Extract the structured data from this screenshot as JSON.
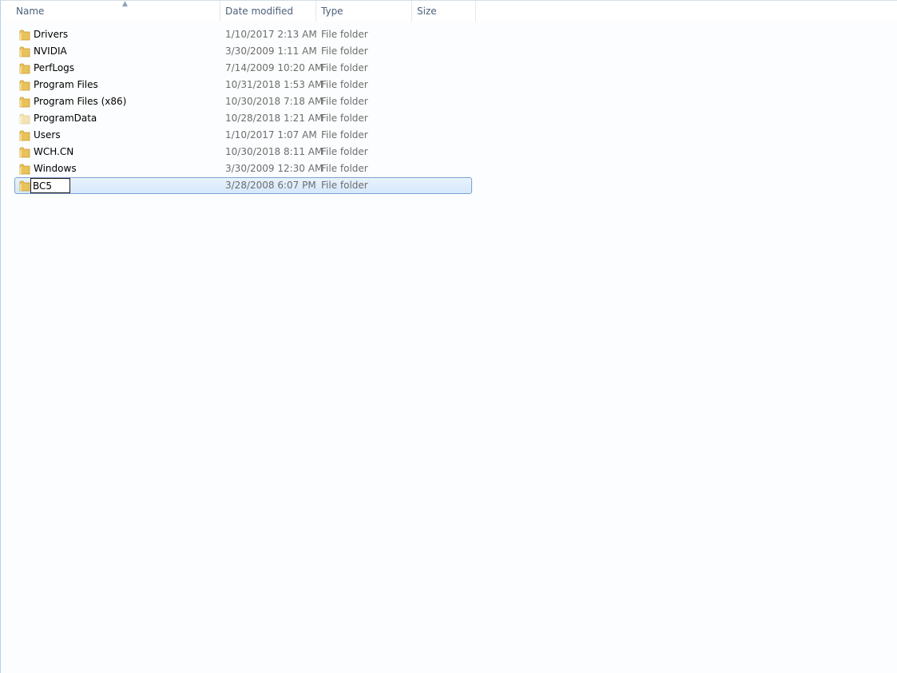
{
  "columns": {
    "name": "Name",
    "date": "Date modified",
    "type": "Type",
    "size": "Size",
    "sort_indicator": "^"
  },
  "files": [
    {
      "name": "Drivers",
      "date": "1/10/2017 2:13 AM",
      "type": "File folder",
      "icon": "folder-icon"
    },
    {
      "name": "NVIDIA",
      "date": "3/30/2009 1:11 AM",
      "type": "File folder",
      "icon": "folder-icon"
    },
    {
      "name": "PerfLogs",
      "date": "7/14/2009 10:20 AM",
      "type": "File folder",
      "icon": "folder-icon"
    },
    {
      "name": "Program Files",
      "date": "10/31/2018 1:53 AM",
      "type": "File folder",
      "icon": "folder-icon"
    },
    {
      "name": "Program Files (x86)",
      "date": "10/30/2018 7:18 AM",
      "type": "File folder",
      "icon": "folder-icon"
    },
    {
      "name": "ProgramData",
      "date": "10/28/2018 1:21 AM",
      "type": "File folder",
      "icon": "hidden-folder-icon"
    },
    {
      "name": "Users",
      "date": "1/10/2017 1:07 AM",
      "type": "File folder",
      "icon": "folder-icon"
    },
    {
      "name": "WCH.CN",
      "date": "10/30/2018 8:11 AM",
      "type": "File folder",
      "icon": "folder-icon"
    },
    {
      "name": "Windows",
      "date": "3/30/2009 12:30 AM",
      "type": "File folder",
      "icon": "folder-icon"
    }
  ],
  "renaming": {
    "value": "BC5",
    "date": "3/28/2008 6:07 PM",
    "type": "File folder",
    "icon": "folder-icon"
  },
  "colors": {
    "selection_border": "#7da2ce",
    "selection_fill": "#d6e8fc",
    "header_text": "#4c607a",
    "folder": "#e8c25a"
  }
}
